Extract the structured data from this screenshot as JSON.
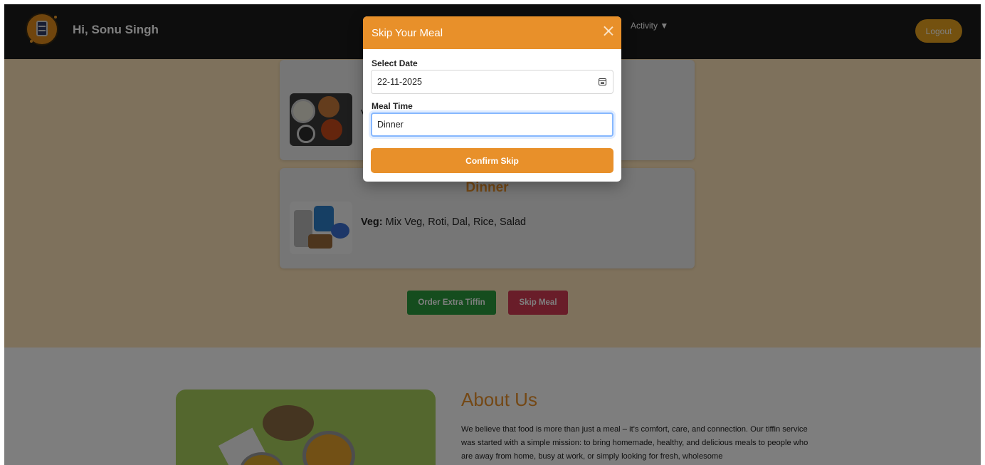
{
  "header": {
    "logo_icon": "tiffin-logo-icon",
    "greeting": "Hi, Sonu Singh",
    "activity_menu": "Activity ▼",
    "logout_label": "Logout"
  },
  "menu": {
    "card1": {
      "title": "",
      "partial_text": "V"
    },
    "card2": {
      "title": "Dinner",
      "veg_label": "Veg:",
      "veg_items": "Mix Veg, Roti, Dal, Rice, Salad"
    },
    "order_extra_label": "Order Extra Tiffin",
    "skip_meal_label": "Skip Meal"
  },
  "about": {
    "title": "About Us",
    "text": "We believe that food is more than just a meal – it's comfort, care, and connection. Our tiffin service was started with a simple mission: to bring homemade, healthy, and delicious meals to people who are away from home, busy at work, or simply looking for fresh, wholesome"
  },
  "modal": {
    "title": "Skip Your Meal",
    "close_icon": "close-icon",
    "date_label": "Select Date",
    "date_value": "22-11-2025",
    "meal_time_label": "Meal Time",
    "meal_time_value": "Dinner",
    "confirm_label": "Confirm Skip"
  },
  "colors": {
    "accent": "#e8902a",
    "navbar": "#1a1a1a",
    "menu_bg": "#fde3b8",
    "green": "#2a9a3c",
    "red": "#d23a52",
    "logout": "#e8a21e"
  }
}
